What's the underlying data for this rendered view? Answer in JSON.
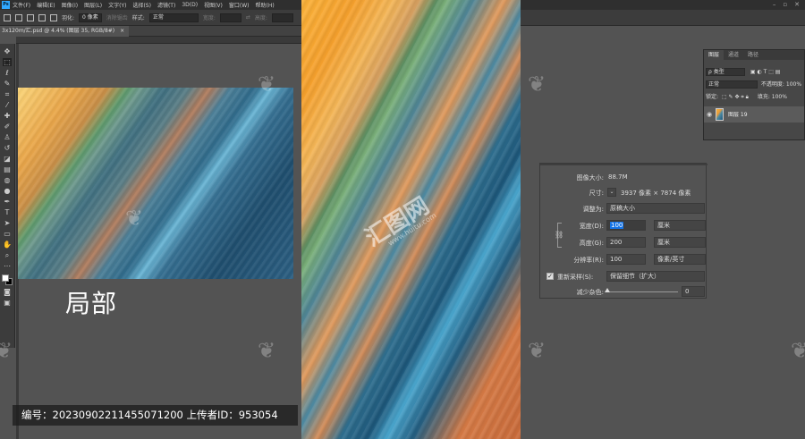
{
  "menubar": {
    "app_icon": "ps-logo-icon",
    "items": [
      "文件(F)",
      "编辑(E)",
      "图像(I)",
      "图层(L)",
      "文字(Y)",
      "选择(S)",
      "滤镜(T)",
      "3D(D)",
      "视图(V)",
      "窗口(W)",
      "帮助(H)"
    ]
  },
  "options": {
    "feather_label": "羽化:",
    "feather_value": "0 像素",
    "antialias_label": "消除锯齿",
    "style_label": "样式:",
    "style_value": "正常",
    "width_label": "宽度:",
    "height_label": "高度:"
  },
  "document": {
    "tab_label": "3x120m/汇.psd @ 4.4% (图层 35, RGB/8#)",
    "tab_close": "×"
  },
  "overlay": {
    "label": "局部",
    "id_bar": "编号：20230902211455071200   上传者ID：953054",
    "watermark_text": "汇图网",
    "watermark_url": "www.huitu.com"
  },
  "layers_panel": {
    "tabs": [
      "图层",
      "通道",
      "路径"
    ],
    "filter_label": "ρ 类型",
    "blend_mode": "正常",
    "opacity_label": "不透明度:",
    "opacity_value": "100%",
    "lock_label": "锁定:",
    "fill_label": "填充:",
    "fill_value": "100%",
    "layer_name": "图层 19"
  },
  "image_size_dialog": {
    "image_size_label": "图像大小:",
    "image_size_value": "88.7M",
    "dimensions_label": "尺寸:",
    "dimensions_value": "3937 像素 × 7874 像素",
    "fit_label": "调整为:",
    "fit_value": "原稿大小",
    "width_label": "宽度(D):",
    "width_value": "100",
    "width_unit": "厘米",
    "height_label": "高度(G):",
    "height_value": "200",
    "height_unit": "厘米",
    "resolution_label": "分辨率(R):",
    "resolution_value": "100",
    "resolution_unit": "像素/英寸",
    "resample_label": "重新采样(S):",
    "resample_value": "保留细节（扩大）",
    "noise_label": "减少杂色:",
    "noise_value": "0"
  }
}
